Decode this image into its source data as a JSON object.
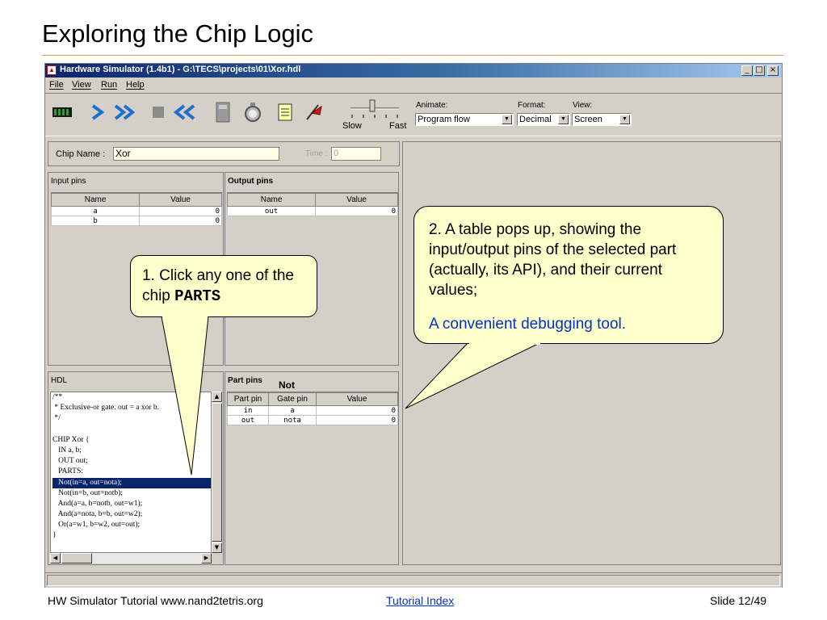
{
  "slide": {
    "title": "Exploring the Chip Logic",
    "footer_left": "HW Simulator Tutorial www.nand2tetris.org",
    "footer_link": "Tutorial Index",
    "footer_right": "Slide 12/49"
  },
  "window": {
    "title": "Hardware Simulator (1.4b1) - G:\\TECS\\projects\\01\\Xor.hdl",
    "menu": [
      "File",
      "View",
      "Run",
      "Help"
    ]
  },
  "toolbar": {
    "slow_label": "Slow",
    "fast_label": "Fast",
    "animate_label": "Animate:",
    "animate_value": "Program flow",
    "format_label": "Format:",
    "format_value": "Decimal",
    "view_label": "View:",
    "view_value": "Screen"
  },
  "chip": {
    "name_label": "Chip Name :",
    "name_value": "Xor",
    "time_label": "Time :",
    "time_value": "0"
  },
  "input_pins": {
    "title": "Input pins",
    "headers": [
      "Name",
      "Value"
    ],
    "rows": [
      [
        "a",
        "0"
      ],
      [
        "b",
        "0"
      ]
    ]
  },
  "output_pins": {
    "title": "Output pins",
    "headers": [
      "Name",
      "Value"
    ],
    "rows": [
      [
        "out",
        "0"
      ]
    ]
  },
  "hdl": {
    "title": "HDL",
    "lines": [
      "/**",
      " * Exclusive-or gate. out = a xor b.",
      " */",
      "",
      "CHIP Xor {",
      "   IN a, b;",
      "   OUT out;",
      "   PARTS:",
      "   Not(in=a, out=nota);",
      "   Not(in=b, out=notb);",
      "   And(a=a, b=notb, out=w1);",
      "   And(a=nota, b=b, out=w2);",
      "   Or(a=w1, b=w2, out=out);",
      "}"
    ],
    "selected_line": 8
  },
  "part_pins": {
    "title": "Part pins",
    "part_name": "Not",
    "headers": [
      "Part pin",
      "Gate pin",
      "Value"
    ],
    "rows": [
      [
        "in",
        "a",
        "0"
      ],
      [
        "out",
        "nota",
        "0"
      ]
    ]
  },
  "callouts": {
    "c1_text": "1. Click any one of the chip ",
    "c1_code": "PARTS",
    "c2_text": "2. A table pops up, showing the input/output pins of the selected part (actually, its API), and their current values;",
    "c2_blue": "A convenient debugging tool."
  },
  "colors": {
    "accent_blue": "#0033cc",
    "selection": "#0a246a",
    "callout_fill": "#ffffcc"
  }
}
